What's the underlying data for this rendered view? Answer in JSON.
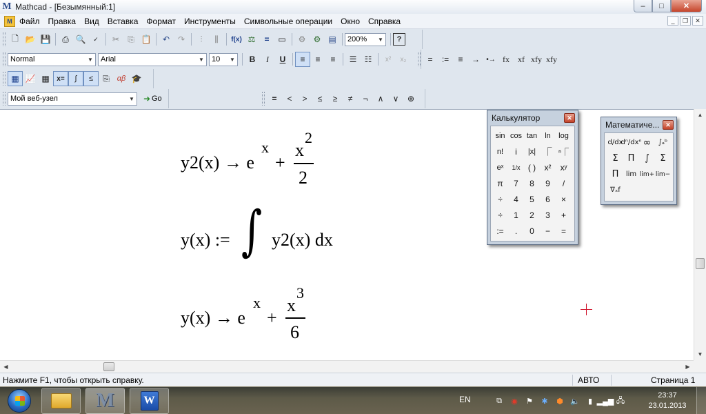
{
  "window": {
    "title": "Mathcad - [Безымянный:1]",
    "controls": {
      "minimize": "–",
      "maximize": "□",
      "close": "✕"
    },
    "doc_controls": {
      "minimize": "_",
      "restore": "❐",
      "close": "✕"
    }
  },
  "menu": [
    "Файл",
    "Правка",
    "Вид",
    "Вставка",
    "Формат",
    "Инструменты",
    "Символьные операции",
    "Окно",
    "Справка"
  ],
  "toolbar": {
    "zoom": "200%",
    "style": "Normal",
    "font": "Arial",
    "size": "10",
    "bold": "B",
    "italic": "I",
    "underline": "U",
    "function_label": "f(x)",
    "symbol_buttons": [
      "=",
      ":=",
      "≡",
      "→",
      "•→",
      "fx",
      "xf",
      "xfy",
      "xfy"
    ],
    "web_address": "Мой веб-узел",
    "go_label": "Go",
    "boolean_ops": [
      "=",
      "<",
      ">",
      "≤",
      "≥",
      "≠",
      "¬",
      "∧",
      "∨",
      "⊕"
    ]
  },
  "worksheet": {
    "expr1": {
      "lhs": "y2(x) → e",
      "sup1": "x",
      "plus": "+",
      "num": "x",
      "num_sup": "2",
      "den": "2"
    },
    "expr2": {
      "lhs": "y(x) :=",
      "integral": "∫",
      "body": "y2(x) dx"
    },
    "expr3": {
      "lhs": "y(x) → e",
      "sup1": "x",
      "plus": "+",
      "num": "x",
      "num_sup": "3",
      "den": "6"
    }
  },
  "calculator": {
    "title": "Калькулятор",
    "keys": [
      "sin",
      "cos",
      "tan",
      "ln",
      "log",
      "n!",
      "i",
      "|x|",
      "⎾",
      "ⁿ⎾",
      "eˣ",
      "1/x",
      "( )",
      "x²",
      "xʸ",
      "π",
      "7",
      "8",
      "9",
      "/",
      "÷",
      "4",
      "5",
      "6",
      "×",
      "÷",
      "1",
      "2",
      "3",
      "+",
      ":=",
      ".",
      "0",
      "−",
      "="
    ]
  },
  "math_palette": {
    "title": "Математиче...",
    "keys": [
      "d/dx",
      "dⁿ/dxⁿ",
      "∞",
      "∫ₐᵇ",
      "Σ",
      "Π",
      "∫",
      "Σ",
      "Π",
      "lim",
      "lim+",
      "lim−",
      "∇ₓf"
    ]
  },
  "status": {
    "help": "Нажмите F1, чтобы открыть справку.",
    "mode": "АВТО",
    "page": "Страница 1"
  },
  "taskbar": {
    "lang": "EN",
    "time": "23:37",
    "date": "23.01.2013"
  }
}
